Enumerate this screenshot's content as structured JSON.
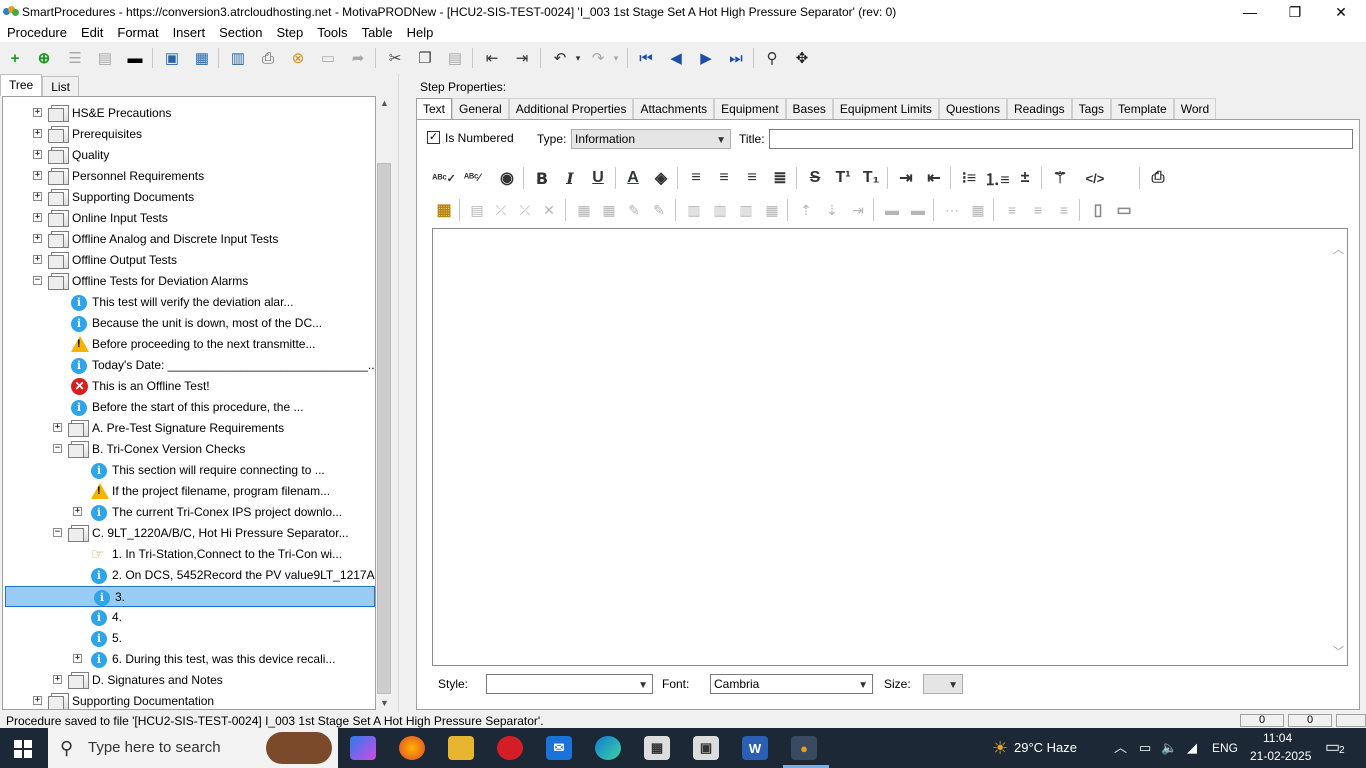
{
  "window": {
    "title": "SmartProcedures - https://conversion3.atrcloudhosting.net - MotivaPRODNew - [HCU2-SIS-TEST-0024] 'I_003 1st Stage Set A Hot High Pressure Separator' (rev: 0)",
    "minimize": "—",
    "restore": "❐",
    "close": "✕"
  },
  "menu": [
    "Procedure",
    "Edit",
    "Format",
    "Insert",
    "Section",
    "Step",
    "Tools",
    "Table",
    "Help"
  ],
  "left": {
    "tabs": [
      "Tree",
      "List"
    ],
    "tree": [
      {
        "label": "HS&E Precautions",
        "icon": "folder",
        "level": 0,
        "expander": "+"
      },
      {
        "label": "Prerequisites",
        "icon": "folder",
        "level": 0,
        "expander": "+"
      },
      {
        "label": "Quality",
        "icon": "folder",
        "level": 0,
        "expander": "+"
      },
      {
        "label": "Personnel Requirements",
        "icon": "folder",
        "level": 0,
        "expander": "+"
      },
      {
        "label": "Supporting Documents",
        "icon": "folder",
        "level": 0,
        "expander": "+"
      },
      {
        "label": "Online Input Tests",
        "icon": "folder",
        "level": 0,
        "expander": "+"
      },
      {
        "label": "Offline Analog and Discrete Input Tests",
        "icon": "folder",
        "level": 0,
        "expander": "+"
      },
      {
        "label": "Offline Output Tests",
        "icon": "folder",
        "level": 0,
        "expander": "+"
      },
      {
        "label": "Offline Tests for Deviation Alarms",
        "icon": "folder",
        "level": 0,
        "expander": "−"
      },
      {
        "label": "This test will verify the deviation alar...",
        "icon": "info",
        "level": 1,
        "expander": ""
      },
      {
        "label": "Because the unit is down, most of the DC...",
        "icon": "info",
        "level": 1,
        "expander": ""
      },
      {
        "label": "Before proceeding to the next transmitte...",
        "icon": "warn",
        "level": 1,
        "expander": ""
      },
      {
        "label": "Today's Date: ______________________________...",
        "icon": "info",
        "level": 1,
        "expander": ""
      },
      {
        "label": "This is an Offline Test!",
        "icon": "error",
        "level": 1,
        "expander": ""
      },
      {
        "label": "Before the start of this procedure, the ...",
        "icon": "info",
        "level": 1,
        "expander": ""
      },
      {
        "label": "A. Pre-Test Signature Requirements",
        "icon": "folder",
        "level": 1,
        "expander": "+"
      },
      {
        "label": "B. Tri-Conex Version Checks",
        "icon": "folder",
        "level": 1,
        "expander": "−"
      },
      {
        "label": "This section will require connecting to ...",
        "icon": "info",
        "level": 2,
        "expander": ""
      },
      {
        "label": "If the project filename, program filenam...",
        "icon": "warn",
        "level": 2,
        "expander": ""
      },
      {
        "label": "The current Tri-Conex IPS project downlo...",
        "icon": "info",
        "level": 2,
        "expander": "+"
      },
      {
        "label": "C. 9LT_1220A/B/C, Hot Hi Pressure Separator...",
        "icon": "folder",
        "level": 1,
        "expander": "−"
      },
      {
        "label": "1. In Tri-Station,Connect to the Tri-Con wi...",
        "icon": "hand",
        "level": 2,
        "expander": ""
      },
      {
        "label": "2. On DCS, 5452Record the PV value9LT_1217A...",
        "icon": "info",
        "level": 2,
        "expander": ""
      },
      {
        "label": "3.",
        "icon": "info",
        "level": 2,
        "expander": "",
        "selected": true
      },
      {
        "label": "4.",
        "icon": "info",
        "level": 2,
        "expander": ""
      },
      {
        "label": "5.",
        "icon": "info",
        "level": 2,
        "expander": ""
      },
      {
        "label": "6. During this test, was this device recali...",
        "icon": "info",
        "level": 2,
        "expander": "+"
      },
      {
        "label": "D. Signatures and Notes",
        "icon": "folder",
        "level": 1,
        "expander": "+"
      },
      {
        "label": "Supporting Documentation",
        "icon": "folder",
        "level": 0,
        "expander": "+"
      }
    ]
  },
  "right": {
    "step_properties_label": "Step Properties:",
    "tabs": [
      "Text",
      "General",
      "Additional Properties",
      "Attachments",
      "Equipment",
      "Bases",
      "Equipment Limits",
      "Questions",
      "Readings",
      "Tags",
      "Template",
      "Word"
    ],
    "is_numbered_label": "Is Numbered",
    "is_numbered_checked": "✓",
    "type_label": "Type:",
    "type_value": "Information",
    "title_label": "Title:",
    "title_value": "",
    "style_label": "Style:",
    "style_value": "",
    "font_label": "Font:",
    "font_value": "Cambria",
    "size_label": "Size:",
    "size_value": ""
  },
  "status": {
    "text": "Procedure saved to file '[HCU2-SIS-TEST-0024] I_003 1st Stage Set A Hot High Pressure Separator'.",
    "box1": "0",
    "box2": "0"
  },
  "taskbar": {
    "search_placeholder": "Type here to search",
    "weather": "29°C  Haze",
    "language": "ENG",
    "time": "11:04",
    "date": "21-02-2025",
    "notifications": "2"
  },
  "colors": {
    "selection": "#99ccf5",
    "info": "#2ea4ea",
    "warn": "#f5b400",
    "error": "#d92020",
    "taskbar": "#1c2836"
  }
}
